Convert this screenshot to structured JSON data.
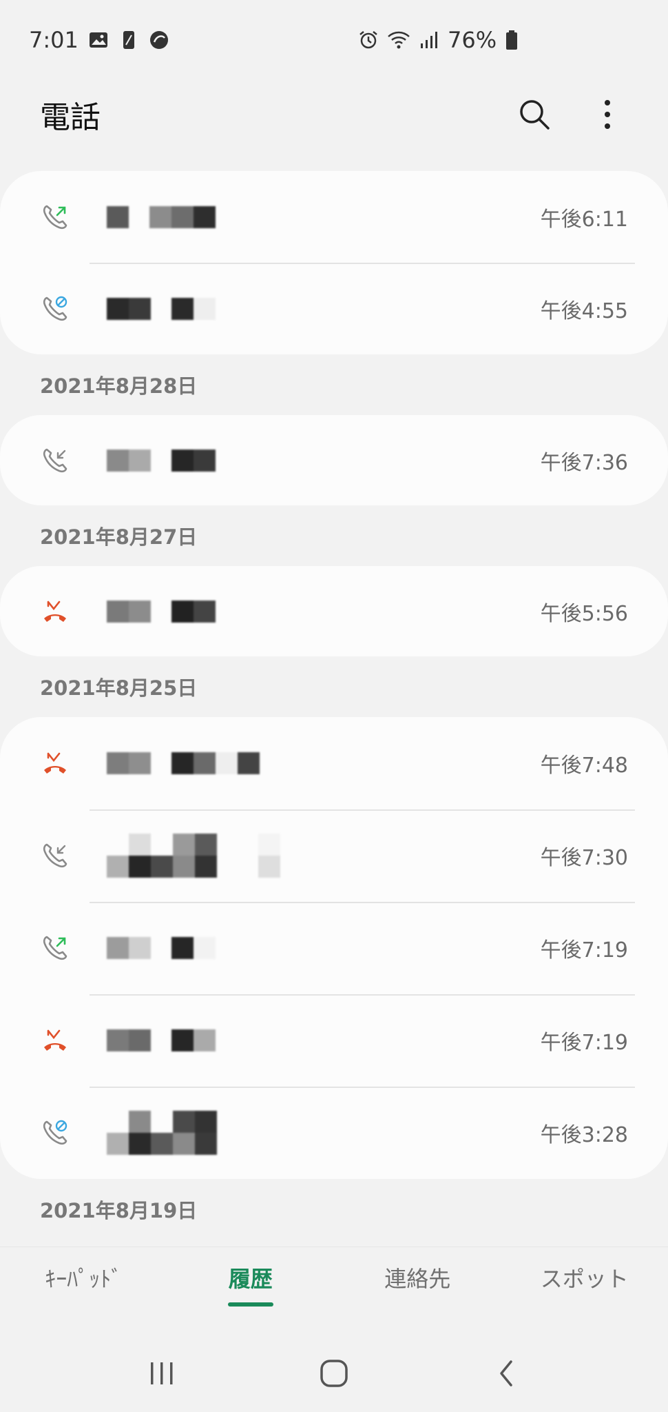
{
  "status_bar": {
    "time": "7:01",
    "battery": "76%",
    "icons": [
      "image-icon",
      "phone-screen-icon",
      "app-icon",
      "alarm-icon",
      "wifi-icon",
      "signal-icon",
      "battery-icon"
    ]
  },
  "header": {
    "title": "電話",
    "icons": [
      "search-icon",
      "more-options-icon"
    ]
  },
  "groups": [
    {
      "date": "",
      "calls": [
        {
          "type": "outgoing",
          "time": "午後6:11"
        },
        {
          "type": "blocked",
          "time": "午後4:55"
        }
      ]
    },
    {
      "date": "2021年8月28日",
      "calls": [
        {
          "type": "incoming",
          "time": "午後7:36"
        }
      ]
    },
    {
      "date": "2021年8月27日",
      "calls": [
        {
          "type": "missed",
          "time": "午後5:56"
        }
      ]
    },
    {
      "date": "2021年8月25日",
      "calls": [
        {
          "type": "missed",
          "time": "午後7:48"
        },
        {
          "type": "incoming",
          "time": "午後7:30"
        },
        {
          "type": "outgoing",
          "time": "午後7:19"
        },
        {
          "type": "missed",
          "time": "午後7:19"
        },
        {
          "type": "blocked",
          "time": "午後3:28"
        }
      ]
    },
    {
      "date": "2021年8月19日",
      "calls": []
    }
  ],
  "tabs": {
    "keypad": "ｷｰﾊﾟｯﾄﾞ",
    "history": "履歴",
    "contacts": "連絡先",
    "spot": "スポット"
  },
  "colors": {
    "accent": "#1a8a5a",
    "missed": "#e0502a",
    "outgoing_arrow": "#2ebd59",
    "blocked": "#3aa7e0"
  }
}
